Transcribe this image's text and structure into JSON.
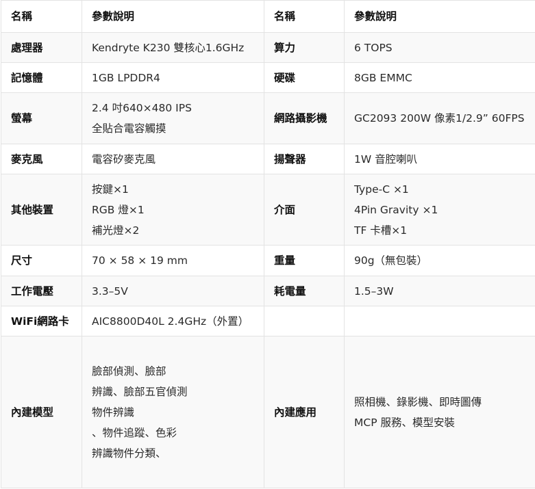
{
  "header": {
    "name_1": "名稱",
    "param_1": "參數說明",
    "name_2": "名稱",
    "param_2": "參數說明"
  },
  "rows": [
    {
      "k1": "處理器",
      "v1": [
        "Kendryte K230 雙核心1.6GHz"
      ],
      "k2": "算力",
      "v2": [
        "6 TOPS"
      ]
    },
    {
      "k1": "記憶體",
      "v1": [
        "1GB LPDDR4"
      ],
      "k2": "硬碟",
      "v2": [
        "8GB EMMC"
      ]
    },
    {
      "k1": "螢幕",
      "v1": [
        "2.4 吋640×480 IPS",
        "全貼合電容觸摸"
      ],
      "k2": "網路攝影機",
      "v2": [
        "GC2093 200W 像素1/2.9” 60FPS"
      ]
    },
    {
      "k1": "麥克風",
      "v1": [
        "電容矽麥克風"
      ],
      "k2": "揚聲器",
      "v2": [
        "1W 音腔喇叭"
      ]
    },
    {
      "k1": "其他裝置",
      "v1": [
        "按鍵×1",
        "RGB 燈×1",
        "補光燈×2"
      ],
      "k2": "介面",
      "v2": [
        "Type-C ×1",
        "4Pin Gravity ×1",
        "TF 卡槽×1"
      ]
    },
    {
      "k1": "尺寸",
      "v1": [
        "70 × 58 × 19 mm"
      ],
      "k2": "重量",
      "v2": [
        "90g（無包裝）"
      ]
    },
    {
      "k1": "工作電壓",
      "v1": [
        "3.3–5V"
      ],
      "k2": "耗電量",
      "v2": [
        "1.5–3W"
      ]
    },
    {
      "k1": "WiFi網路卡",
      "v1": [
        "AIC8800D40L 2.4GHz（外置）"
      ],
      "k2": "",
      "v2": [
        ""
      ]
    },
    {
      "k1": "內建模型",
      "v1": [
        "臉部偵測、臉部",
        "辨識、臉部五官偵測",
        "物件辨識",
        "、物件追蹤、色彩",
        "辨識物件分類、"
      ],
      "k2": "內建應用",
      "v2": [
        "照相機、錄影機、即時圖傳",
        "MCP 服務、模型安裝"
      ]
    }
  ]
}
